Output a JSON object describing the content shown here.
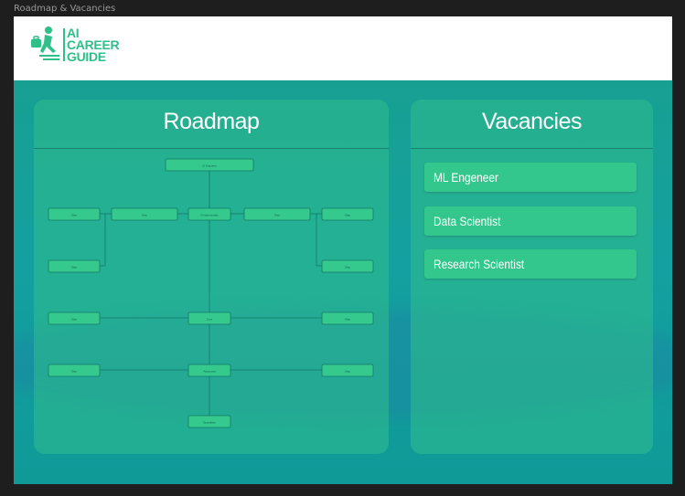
{
  "window": {
    "title": "Roadmap & Vacancies"
  },
  "logo": {
    "line1": "AI",
    "line2": "CAREER",
    "line3": "GUIDE"
  },
  "roadmap": {
    "title": "Roadmap",
    "nodes": [
      {
        "id": "top",
        "label": "AI Engineer"
      },
      {
        "id": "l1a",
        "label": "Step"
      },
      {
        "id": "l1b",
        "label": "Step"
      },
      {
        "id": "c1",
        "label": "Fundamentals"
      },
      {
        "id": "r1a",
        "label": "Step"
      },
      {
        "id": "r1b",
        "label": "Step"
      },
      {
        "id": "l2",
        "label": "Step"
      },
      {
        "id": "r2",
        "label": "Step"
      },
      {
        "id": "l3",
        "label": "Step"
      },
      {
        "id": "c3",
        "label": "Core"
      },
      {
        "id": "r3",
        "label": "Step"
      },
      {
        "id": "l4",
        "label": "Step"
      },
      {
        "id": "c4",
        "label": "Advanced"
      },
      {
        "id": "r4",
        "label": "Step"
      },
      {
        "id": "c5",
        "label": "Specialize"
      }
    ]
  },
  "vacancies": {
    "title": "Vacancies",
    "items": [
      {
        "label": "ML Engeneer"
      },
      {
        "label": "Data Scientist"
      },
      {
        "label": "Research Scientist"
      }
    ]
  },
  "colors": {
    "accent": "#2fbf88",
    "background": "#0e9a90",
    "panel": "#33c78d"
  }
}
